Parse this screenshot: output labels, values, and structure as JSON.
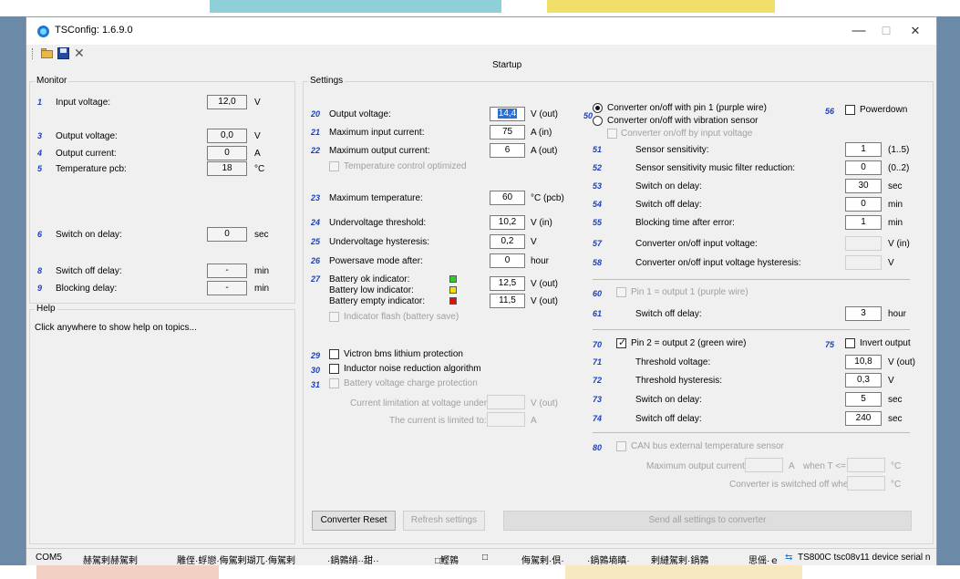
{
  "window": {
    "title": "TSConfig: 1.6.9.0",
    "minimize": "—",
    "maximize": "☐",
    "close": "✕"
  },
  "page_title": "Startup",
  "monitor": {
    "legend": "Monitor",
    "rows": [
      {
        "num": "1",
        "label": "Input voltage:",
        "value": "12,0",
        "unit": "V"
      },
      {
        "num": "3",
        "label": "Output voltage:",
        "value": "0,0",
        "unit": "V"
      },
      {
        "num": "4",
        "label": "Output current:",
        "value": "0",
        "unit": "A"
      },
      {
        "num": "5",
        "label": "Temperature pcb:",
        "value": "18",
        "unit": "°C"
      },
      {
        "num": "6",
        "label": "Switch on delay:",
        "value": "0",
        "unit": "sec"
      },
      {
        "num": "8",
        "label": "Switch off delay:",
        "value": "-",
        "unit": "min"
      },
      {
        "num": "9",
        "label": "Blocking delay:",
        "value": "-",
        "unit": "min"
      }
    ]
  },
  "help": {
    "legend": "Help",
    "text": "Click anywhere to show help on topics..."
  },
  "settings": {
    "legend": "Settings",
    "left": {
      "output_voltage": {
        "num": "20",
        "label": "Output voltage:",
        "value": "14,4",
        "unit": "V (out)"
      },
      "max_input_current": {
        "num": "21",
        "label": "Maximum input current:",
        "value": "75",
        "unit": "A (in)"
      },
      "max_output_current": {
        "num": "22",
        "label": "Maximum output current:",
        "value": "6",
        "unit": "A (out)"
      },
      "temp_control": "Temperature control optimized",
      "max_temp": {
        "num": "23",
        "label": "Maximum temperature:",
        "value": "60",
        "unit": "°C (pcb)"
      },
      "uv_threshold": {
        "num": "24",
        "label": "Undervoltage threshold:",
        "value": "10,2",
        "unit": "V (in)"
      },
      "uv_hysteresis": {
        "num": "25",
        "label": "Undervoltage hysteresis:",
        "value": "0,2",
        "unit": "V"
      },
      "powersave": {
        "num": "26",
        "label": "Powersave mode after:",
        "value": "0",
        "unit": "hour"
      },
      "battery": {
        "num": "27",
        "ok_label": "Battery ok indicator:",
        "low_label": "Battery low indicator:",
        "empty_label": "Battery empty indicator:",
        "value1": "12,5",
        "unit1": "V (out)",
        "value2": "11,5",
        "unit2": "V (out)",
        "ok_color": "#2ecc2e",
        "low_color": "#f2e200",
        "empty_color": "#e01010"
      },
      "indicator_flash": "Indicator flash (battery save)",
      "victron": {
        "num": "29",
        "label": "Victron bms lithium protection"
      },
      "inductor": {
        "num": "30",
        "label": "Inductor noise reduction algorithm"
      },
      "charge_prot": {
        "num": "31",
        "label": "Battery voltage charge protection"
      },
      "current_limit": {
        "label": "Current limitation at voltage under:",
        "unit": "V (out)"
      },
      "limited_to": {
        "label": "The current is limited to:",
        "unit": "A"
      }
    },
    "right": {
      "num50": "50",
      "radio_pin1": "Converter on/off with pin 1 (purple wire)",
      "radio_vibration": "Converter on/off with vibration sensor",
      "by_input_voltage": "Converter on/off by input voltage",
      "powerdown": {
        "num": "56",
        "label": "Powerdown"
      },
      "sensor_sens": {
        "num": "51",
        "label": "Sensor sensitivity:",
        "value": "1",
        "unit": "(1..5)"
      },
      "music_filter": {
        "num": "52",
        "label": "Sensor sensitivity music filter reduction:",
        "value": "0",
        "unit": "(0..2)"
      },
      "switch_on": {
        "num": "53",
        "label": "Switch on delay:",
        "value": "30",
        "unit": "sec"
      },
      "switch_off": {
        "num": "54",
        "label": "Switch off delay:",
        "value": "0",
        "unit": "min"
      },
      "blocking": {
        "num": "55",
        "label": "Blocking time after error:",
        "value": "1",
        "unit": "min"
      },
      "input_voltage": {
        "num": "57",
        "label": "Converter on/off input voltage:",
        "unit": "V (in)"
      },
      "input_hyst": {
        "num": "58",
        "label": "Converter on/off input voltage hysteresis:",
        "unit": "V"
      },
      "pin1_out": {
        "num": "60",
        "label": "Pin 1 = output 1 (purple wire)"
      },
      "pin1_switch_off": {
        "num": "61",
        "label": "Switch off delay:",
        "value": "3",
        "unit": "hour"
      },
      "pin2_out": {
        "num": "70",
        "label": "Pin 2 = output 2 (green wire)"
      },
      "invert": {
        "num": "75",
        "label": "Invert output"
      },
      "threshold_v": {
        "num": "71",
        "label": "Threshold voltage:",
        "value": "10,8",
        "unit": "V (out)"
      },
      "threshold_h": {
        "num": "72",
        "label": "Threshold hysteresis:",
        "value": "0,3",
        "unit": "V"
      },
      "pin2_on": {
        "num": "73",
        "label": "Switch on delay:",
        "value": "5",
        "unit": "sec"
      },
      "pin2_off": {
        "num": "74",
        "label": "Switch off delay:",
        "value": "240",
        "unit": "sec"
      },
      "can_bus": {
        "num": "80",
        "label": "CAN bus external temperature sensor"
      },
      "can_max": {
        "label": "Maximum output current:",
        "unit": "A",
        "when": "when T <=",
        "unit2": "°C"
      },
      "can_off": {
        "label": "Converter is switched off when T <=",
        "unit": "°C"
      }
    },
    "buttons": {
      "reset": "Converter Reset",
      "refresh": "Refresh settings",
      "send": "Send all settings to converter"
    }
  },
  "statusbar": {
    "port": "COM5",
    "s1": "赫駕剌赫駕剌",
    "s2": "雕侄·蜉戀·侮駕剌瑚兀·侮駕剌",
    "s3": "·鍋鶉綃··甜··",
    "s4": "□鰹鶉",
    "s5": "□",
    "s6": "侮駕剌·倶·",
    "s7": "·鍋鶉墒瞋·",
    "s8": "剌縺駕剌·鍋鶉",
    "s9": "思傜·ｅ",
    "device": "TS800C  tsc08v11  device serial n"
  }
}
